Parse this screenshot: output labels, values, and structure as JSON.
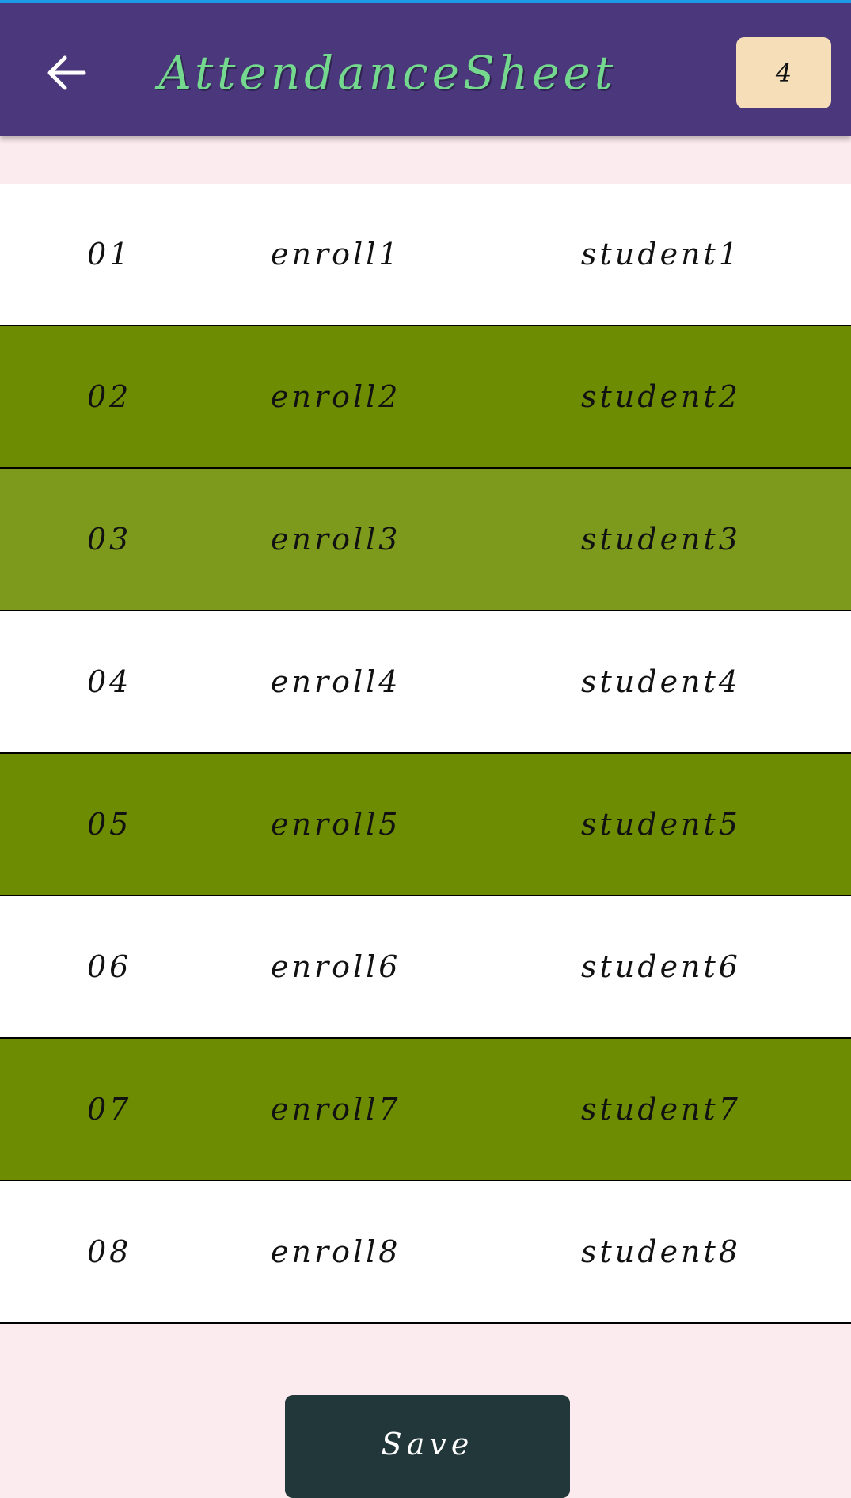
{
  "header": {
    "title": "AttendanceSheet",
    "count": "4",
    "bar_color": "#4b387c",
    "title_color": "#74d98f"
  },
  "rows": [
    {
      "num": "01",
      "enroll": "enroll1",
      "name": "student1",
      "style": "white"
    },
    {
      "num": "02",
      "enroll": "enroll2",
      "name": "student2",
      "style": "olive"
    },
    {
      "num": "03",
      "enroll": "enroll3",
      "name": "student3",
      "style": "olive-light"
    },
    {
      "num": "04",
      "enroll": "enroll4",
      "name": "student4",
      "style": "white"
    },
    {
      "num": "05",
      "enroll": "enroll5",
      "name": "student5",
      "style": "olive"
    },
    {
      "num": "06",
      "enroll": "enroll6",
      "name": "student6",
      "style": "white"
    },
    {
      "num": "07",
      "enroll": "enroll7",
      "name": "student7",
      "style": "olive"
    },
    {
      "num": "08",
      "enroll": "enroll8",
      "name": "student8",
      "style": "white"
    }
  ],
  "footer": {
    "save_label": "Save"
  },
  "icons": {
    "back": "arrow-left-icon"
  },
  "colors": {
    "selected_row": "#6e8c02",
    "selected_row_alt": "#7d9a1c",
    "unselected_row": "#ffffff",
    "background": "#fbeaee",
    "save_button": "#223739"
  }
}
